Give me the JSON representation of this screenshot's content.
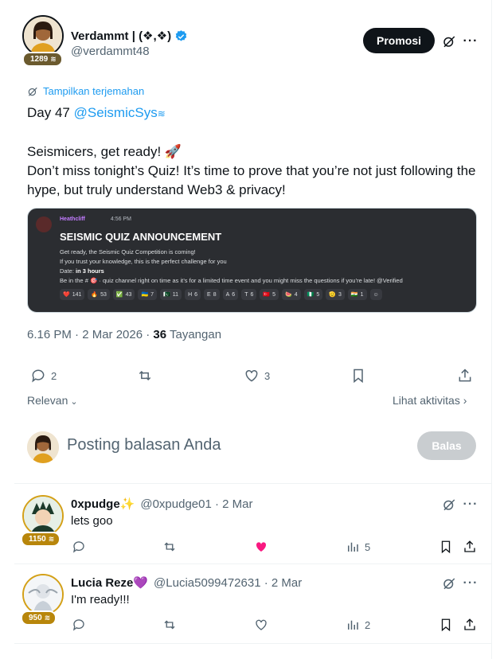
{
  "post": {
    "author_name": "Verdammt | (❖,❖)",
    "author_handle": "@verdammt48",
    "badge_count": "1289",
    "promo_label": "Promosi",
    "translate_label": "Tampilkan terjemahan",
    "line1_prefix": "Day 47 ",
    "line1_mention": "@SeismicSys",
    "line2": "Seismicers, get ready! 🚀",
    "line3": "Don’t miss tonight’s Quiz! It’s time to prove that you’re not just following the hype, but truly understand Web3 & privacy!",
    "timestamp": "6.16 PM · 2 Mar 2026 · ",
    "views_count": "36",
    "views_label": " Tayangan",
    "replies": "2",
    "likes": "3",
    "relevan_label": "Relevan",
    "activity_label": "Lihat aktivitas"
  },
  "embed": {
    "user": "Heathcliff",
    "time": "4:56 PM",
    "title": "SEISMIC QUIZ ANNOUNCEMENT",
    "line1": "Get ready, the Seismic Quiz Competition is coming!",
    "line2": "If you trust your knowledge, this is the perfect challenge for you",
    "line3_prefix": "Date:   ",
    "line3_bold": "in 3 hours",
    "line4": "Be in the # 🎯 · quiz channel right on time as it’s for a limited time event and you might miss the questions if you’re late!  @Verified",
    "reactions": [
      {
        "emoji": "❤️",
        "count": "141"
      },
      {
        "emoji": "🔥",
        "count": "53"
      },
      {
        "emoji": "✅",
        "count": "43"
      },
      {
        "emoji": "🇺🇦",
        "count": "7"
      },
      {
        "emoji": "🇵🇰",
        "count": "11"
      },
      {
        "emoji": "H",
        "count": "6"
      },
      {
        "emoji": "E",
        "count": "8"
      },
      {
        "emoji": "A",
        "count": "6"
      },
      {
        "emoji": "T",
        "count": "6"
      },
      {
        "emoji": "🇹🇷",
        "count": "5"
      },
      {
        "emoji": "🍉",
        "count": "4"
      },
      {
        "emoji": "🇳🇬",
        "count": "5"
      },
      {
        "emoji": "🫡",
        "count": "3"
      },
      {
        "emoji": "🇮🇳",
        "count": "1"
      },
      {
        "emoji": "☺",
        "count": ""
      }
    ]
  },
  "reply_box": {
    "placeholder": "Posting balasan Anda",
    "button": "Balas"
  },
  "replies": [
    {
      "name": "0xpudge✨",
      "handle": "@0xpudge01 · 2 Mar",
      "text": "lets goo",
      "badge": "1150",
      "views": "5"
    },
    {
      "name": "Lucia Reze💜",
      "handle": "@Lucia5099472631 · 2 Mar",
      "text": "I'm ready!!!",
      "badge": "950",
      "views": "2"
    }
  ],
  "colors": {
    "accent": "#1d9bf0",
    "like_active": "#f91880",
    "badge_gold": "#b8860b"
  }
}
